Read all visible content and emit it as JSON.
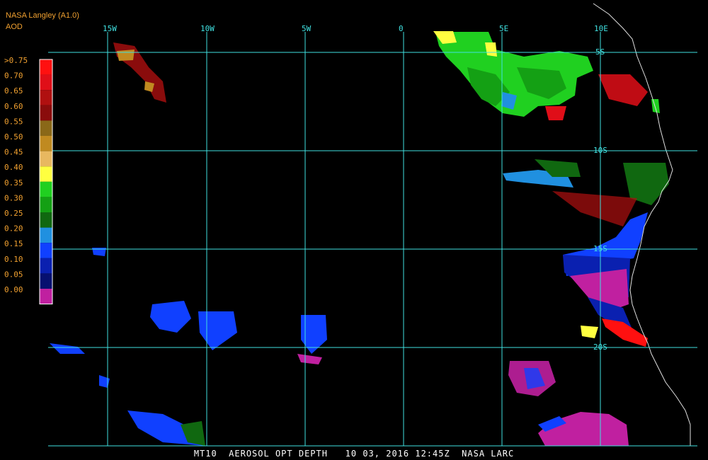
{
  "header": {
    "org": "NASA Langley (A1.0)",
    "product": "AOD"
  },
  "footer": "MT10  AEROSOL OPT DEPTH   10 03, 2016 12:45Z  NASA LARC",
  "legend": {
    "labels": [
      ">0.75",
      "0.70",
      "0.65",
      "0.60",
      "0.55",
      "0.50",
      "0.45",
      "0.40",
      "0.35",
      "0.30",
      "0.25",
      "0.20",
      "0.15",
      "0.10",
      "0.05",
      "0.00"
    ],
    "colors": [
      "#ff1010",
      "#e00e18",
      "#b01010",
      "#8a0c0c",
      "#8a6818",
      "#c08a20",
      "#e8b860",
      "#ffff40",
      "#20d020",
      "#14a014",
      "#106810",
      "#2090e0",
      "#1040ff",
      "#0a20b0",
      "#061070",
      "#c020a0"
    ]
  },
  "grid": {
    "lon_labels": [
      "15W",
      "10W",
      "5W",
      "0",
      "5E",
      "10E"
    ],
    "lat_labels": [
      "5S",
      "10S",
      "15S",
      "20S"
    ]
  }
}
